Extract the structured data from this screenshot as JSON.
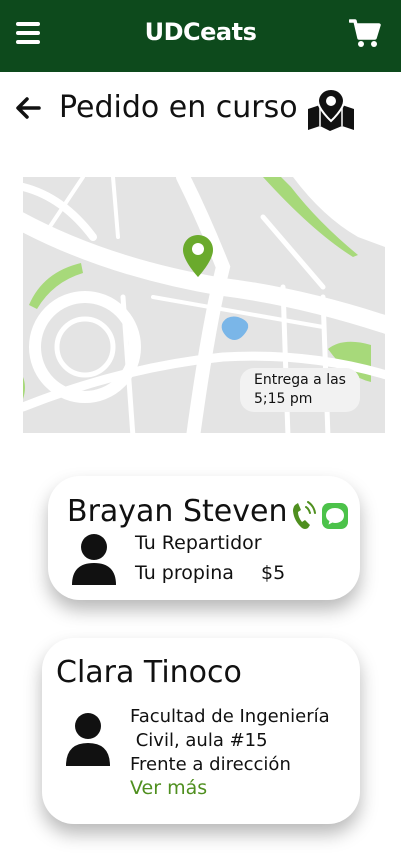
{
  "header": {
    "app_title": "UDCeats",
    "menu_icon": "hamburger-menu-icon",
    "cart_icon": "shopping-cart-icon"
  },
  "page": {
    "title": "Pedido en curso",
    "back_icon": "back-arrow-icon",
    "map_icon": "map-pin-icon"
  },
  "map": {
    "delivery_line1": "Entrega a las",
    "delivery_line2": "5;15 pm",
    "marker_icon": "location-marker-icon",
    "marker_color": "#6aaa2c",
    "park_color": "#a7d97a",
    "water_color": "#7ab6e8"
  },
  "courier": {
    "name": "Brayan Steven",
    "role": "Tu Repartidor",
    "tip_label": "Tu propina",
    "tip_value": "$5",
    "call_icon": "phone-call-icon",
    "message_icon": "message-icon",
    "avatar_icon": "person-icon"
  },
  "customer": {
    "name": "Clara Tinoco",
    "address_line1": "Facultad de Ingeniería",
    "address_line2": " Civil, aula #15",
    "address_line3": "Frente a dirección",
    "see_more": "Ver más",
    "avatar_icon": "person-icon"
  },
  "colors": {
    "header_bg": "#0d4a1c",
    "accent_green": "#4f8f1f"
  }
}
